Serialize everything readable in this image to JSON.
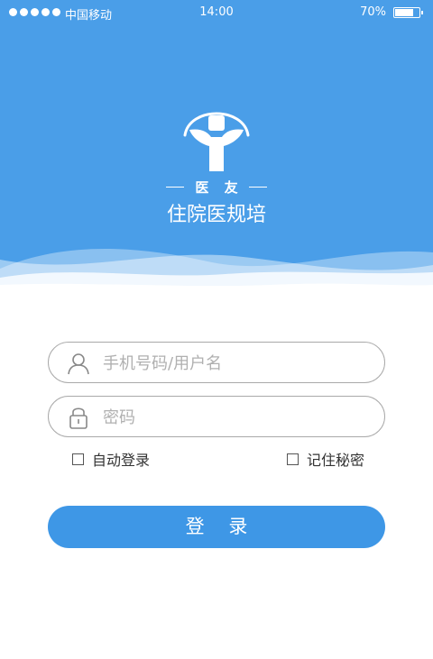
{
  "status_bar": {
    "carrier": "中国移动",
    "time": "14:00",
    "battery_percent": "70%",
    "battery_level": 0.7,
    "signal_dots": 5
  },
  "header": {
    "logo_icon": "doctor-figure-icon",
    "logo_subtitle": "医 友",
    "app_title": "住院医规培",
    "background_color": "#4a9ee8"
  },
  "form": {
    "username": {
      "placeholder": "手机号码/用户名",
      "value": "",
      "icon": "user-icon"
    },
    "password": {
      "placeholder": "密码",
      "value": "",
      "icon": "lock-icon"
    },
    "auto_login": {
      "label": "自动登录",
      "checked": false
    },
    "remember_password": {
      "label": "记住秘密",
      "checked": false
    },
    "login_button": "登 录",
    "accent_color": "#3e97e6"
  }
}
